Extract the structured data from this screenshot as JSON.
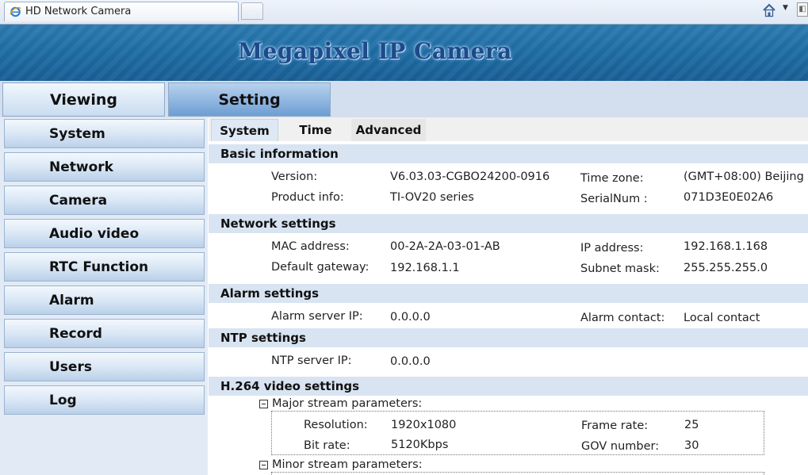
{
  "browser": {
    "tab_title": "HD Network Camera",
    "icons": [
      "ie-page-icon",
      "home-icon",
      "chevron-down-icon",
      "feed-icon"
    ]
  },
  "banner": {
    "title": "Megapixel IP Camera"
  },
  "top_tabs": [
    {
      "label": "Viewing",
      "active": false
    },
    {
      "label": "Setting",
      "active": true
    }
  ],
  "sidebar": {
    "items": [
      {
        "label": "System"
      },
      {
        "label": "Network"
      },
      {
        "label": "Camera"
      },
      {
        "label": "Audio video"
      },
      {
        "label": "RTC Function"
      },
      {
        "label": "Alarm"
      },
      {
        "label": "Record"
      },
      {
        "label": "Users"
      },
      {
        "label": "Log"
      }
    ]
  },
  "sub_tabs": [
    {
      "label": "System",
      "active": true
    },
    {
      "label": "Time",
      "active": false
    },
    {
      "label": "Advanced",
      "active": false
    }
  ],
  "basic": {
    "heading": "Basic information",
    "version_label": "Version:",
    "version_value": "V6.03.03-CGBO24200-0916",
    "timezone_label": "Time zone:",
    "timezone_value": "(GMT+08:00) Beijing",
    "product_label": "Product info:",
    "product_value": "TI-OV20 series",
    "serial_label": "SerialNum :",
    "serial_value": "071D3E0E02A6"
  },
  "network": {
    "heading": "Network settings",
    "mac_label": "MAC address:",
    "mac_value": "00-2A-2A-03-01-AB",
    "ip_label": "IP address:",
    "ip_value": "192.168.1.168",
    "gateway_label": "Default gateway:",
    "gateway_value": "192.168.1.1",
    "subnet_label": "Subnet mask:",
    "subnet_value": "255.255.255.0"
  },
  "alarm": {
    "heading": "Alarm settings",
    "server_label": "Alarm server IP:",
    "server_value": "0.0.0.0",
    "contact_label": "Alarm contact:",
    "contact_value": "Local contact"
  },
  "ntp": {
    "heading": "NTP settings",
    "server_label": "NTP server IP:",
    "server_value": "0.0.0.0"
  },
  "h264": {
    "heading": "H.264 video settings",
    "major": {
      "title": "Major stream parameters:",
      "resolution_label": "Resolution:",
      "resolution_value": "1920x1080",
      "framerate_label": "Frame rate:",
      "framerate_value": "25",
      "bitrate_label": "Bit rate:",
      "bitrate_value": "5120Kbps",
      "gov_label": "GOV number:",
      "gov_value": "30"
    },
    "minor": {
      "title": "Minor stream parameters:"
    }
  },
  "colors": {
    "banner": "#1f6ea7",
    "banner_title": "#1e4a8a",
    "section_header": "#d8e4f2",
    "sidebar_bg": "#e2ebf5",
    "active_tab": "#6d9ed3"
  }
}
